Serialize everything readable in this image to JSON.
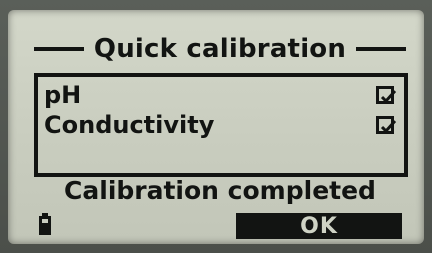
{
  "dialog": {
    "title": "Quick calibration",
    "items": [
      {
        "label": "pH",
        "checked": true
      },
      {
        "label": "Conductivity",
        "checked": true
      }
    ],
    "status": "Calibration completed",
    "ok_label": "OK"
  },
  "icons": {
    "battery": "battery-icon",
    "checkbox": "checkbox-checked-icon"
  },
  "colors": {
    "lcd_background": "#c9cdbf",
    "pixel_on": "#121412"
  }
}
